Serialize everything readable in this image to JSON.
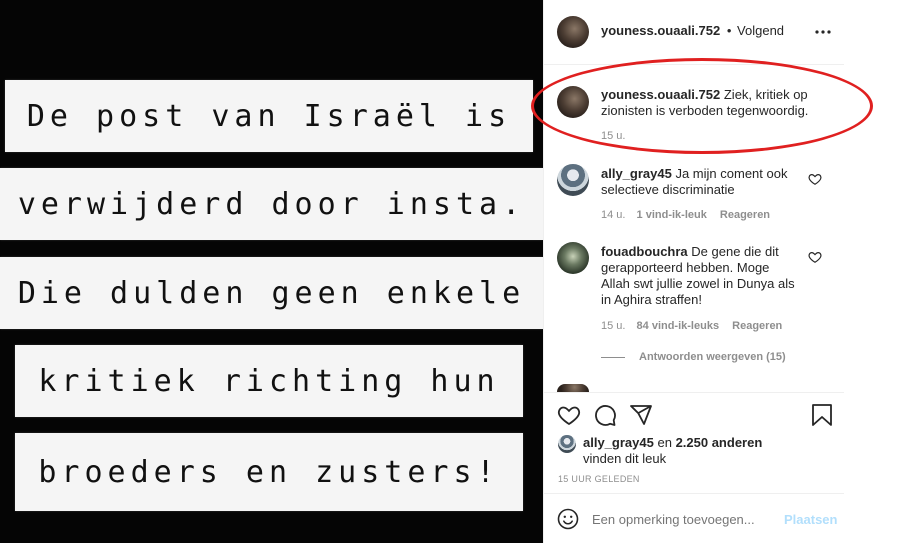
{
  "image_text": {
    "lines": [
      "De post van Israël is",
      "verwijderd door insta.",
      "Die dulden geen enkele",
      "kritiek richting hun",
      "broeders en zusters!"
    ]
  },
  "header": {
    "username": "youness.ouaali.752",
    "separator": "•",
    "follow_status": "Volgend",
    "more_icon": "more-horizontal-icon"
  },
  "caption": {
    "username": "youness.ouaali.752",
    "text": "Ziek, kritiek op zionisten is verboden tegenwoordig.",
    "time": "15 u."
  },
  "comments": [
    {
      "username": "ally_gray45",
      "text": "Ja mijn coment ook selectieve discriminatie",
      "time": "14 u.",
      "likes": "1 vind-ik-leuk",
      "reply": "Reageren"
    },
    {
      "username": "fouadbouchra",
      "text": "De gene die dit gerapporteerd hebben. Moge Allah swt jullie zowel in Dunya als in Aghira straffen!",
      "time": "15 u.",
      "likes": "84 vind-ik-leuks",
      "reply": "Reageren",
      "view_replies": "Antwoorden weergeven (15)"
    }
  ],
  "actions": {
    "icons": [
      "heart-icon",
      "comment-icon",
      "share-icon",
      "bookmark-icon"
    ]
  },
  "likes": {
    "user": "ally_gray45",
    "connector": "en",
    "others": "2.250 anderen",
    "suffix": "vinden dit leuk"
  },
  "timestamp": "15 UUR GELEDEN",
  "add_comment": {
    "placeholder": "Een opmerking toevoegen...",
    "post_label": "Plaatsen",
    "emoji_icon": "emoji-icon"
  },
  "colors": {
    "highlight_ellipse": "#e02020",
    "post_button": "#b2dffc",
    "image_background": "#050505"
  }
}
